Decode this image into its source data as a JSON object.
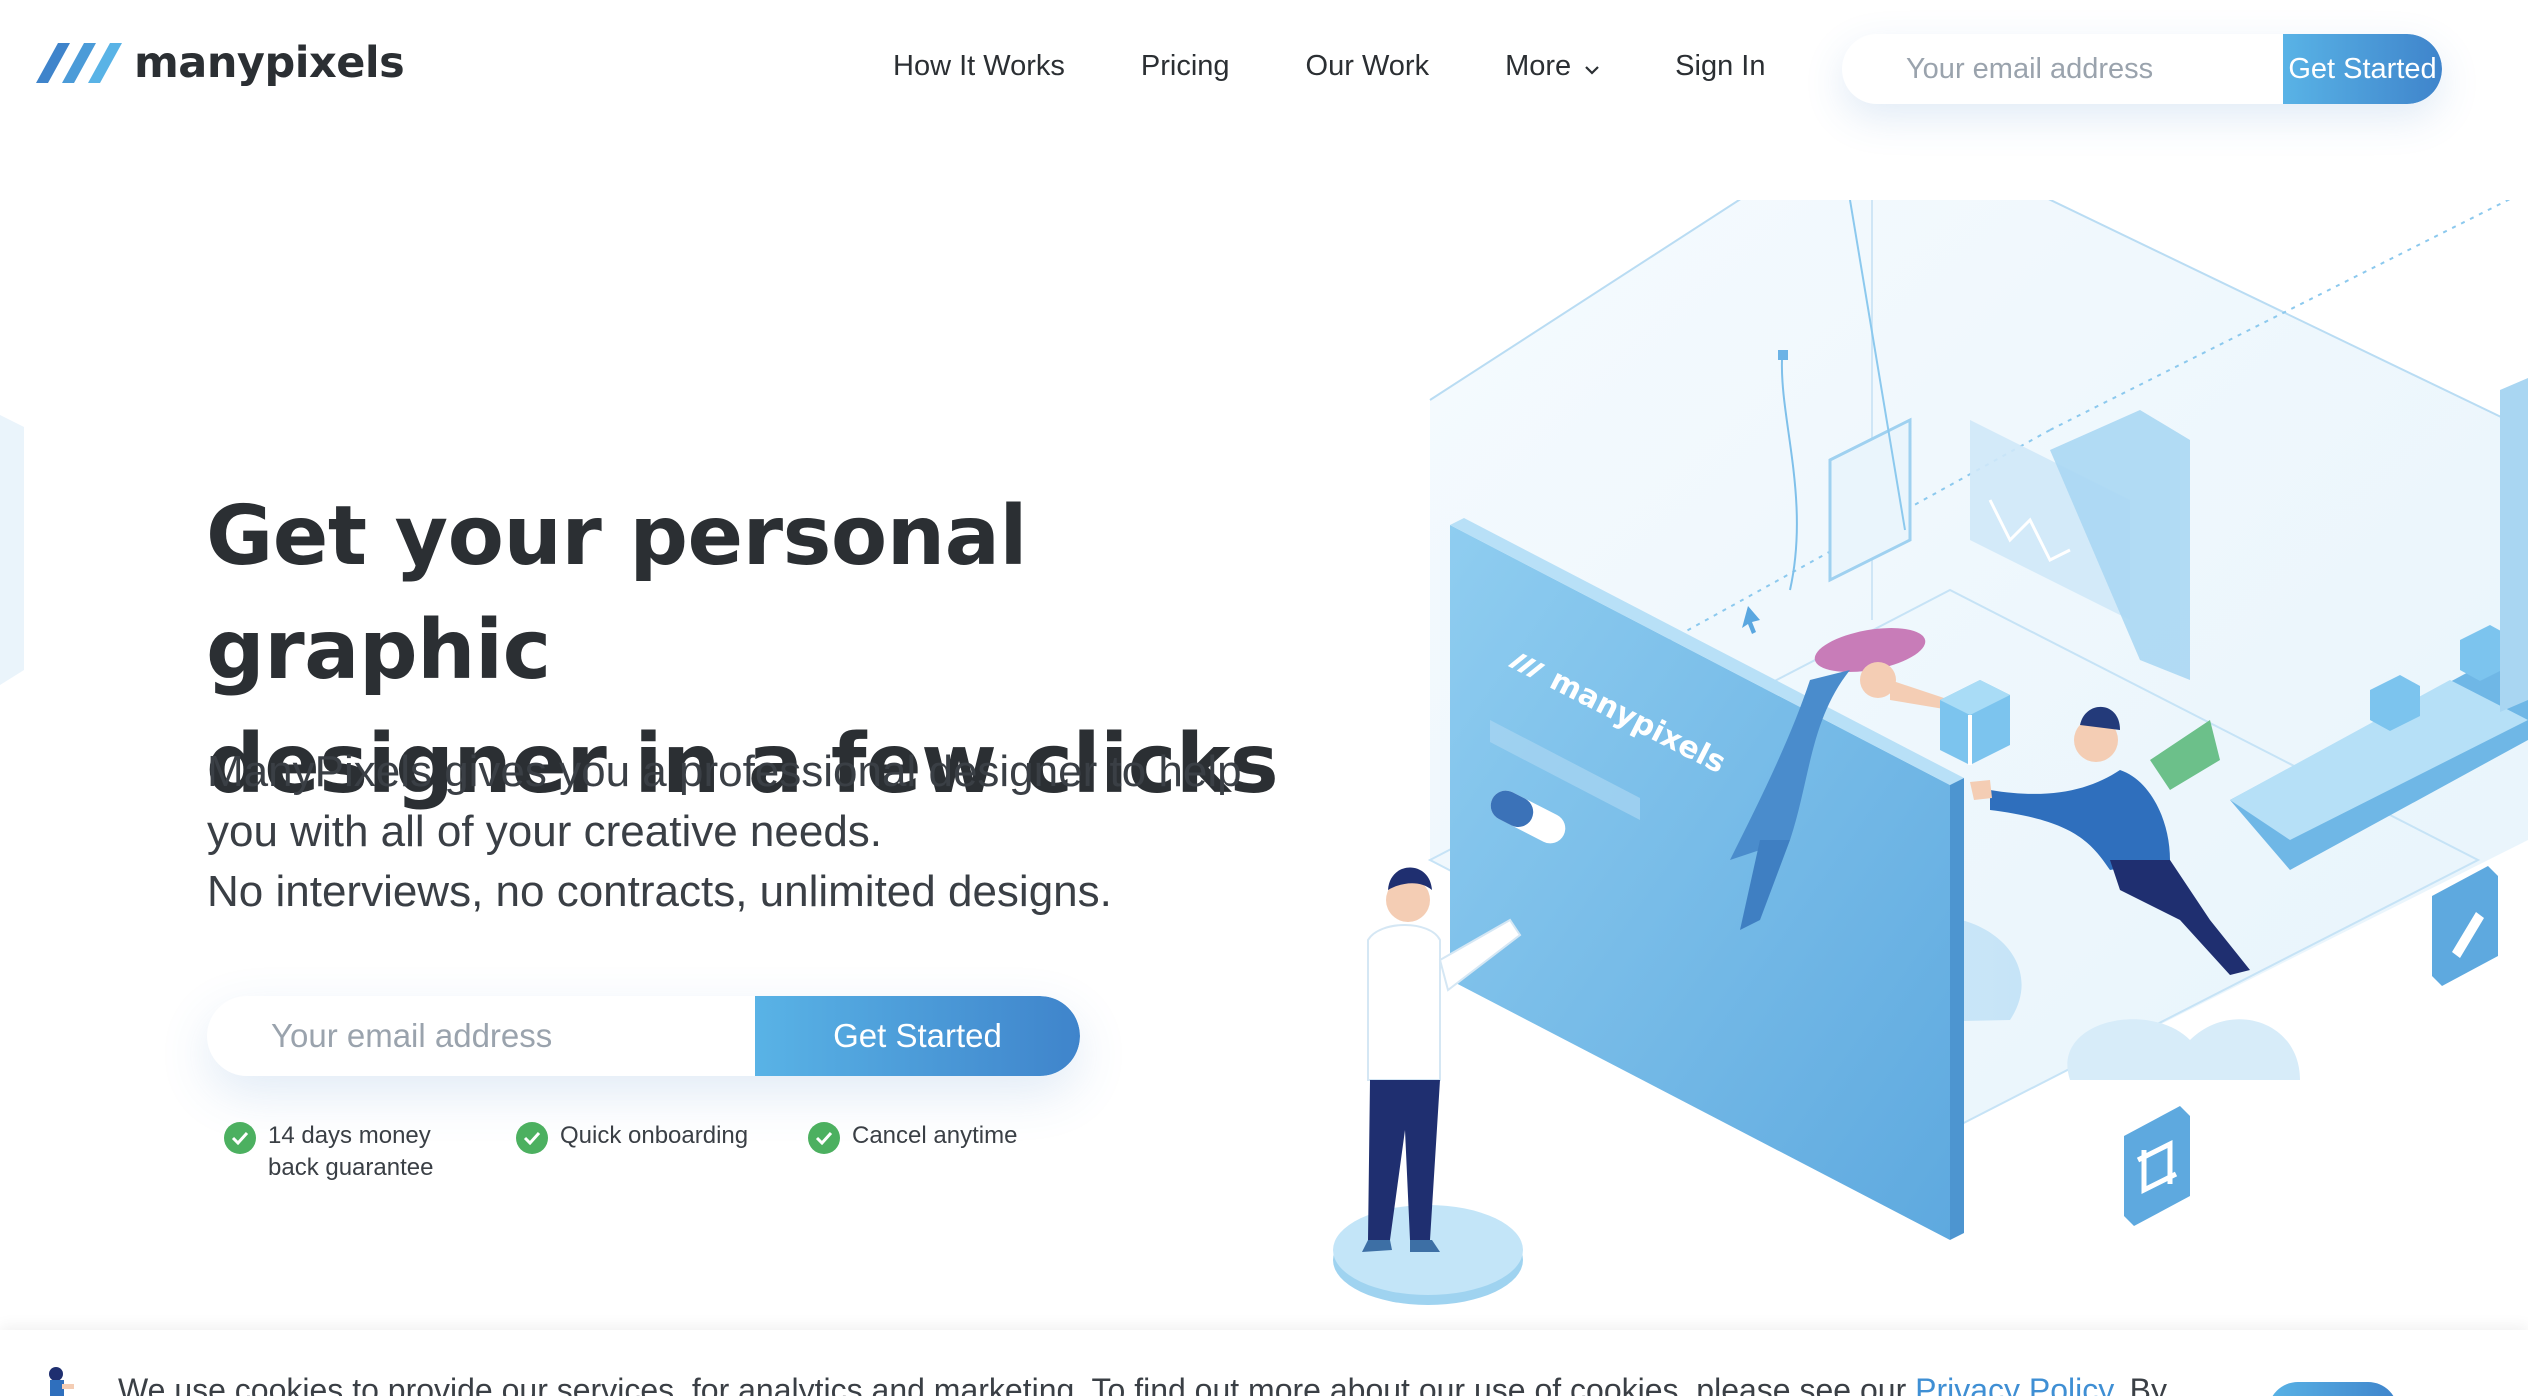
{
  "brand": {
    "name": "manypixels",
    "accent_color": "#4a90d6",
    "button_gradient": [
      "#59b3e6",
      "#3f84cb"
    ],
    "check_color": "#4cb060"
  },
  "nav": {
    "items": [
      {
        "label": "How It Works"
      },
      {
        "label": "Pricing"
      },
      {
        "label": "Our Work"
      },
      {
        "label": "More",
        "icon": "chevron-down-icon"
      },
      {
        "label": "Sign In"
      }
    ]
  },
  "header_form": {
    "placeholder": "Your email address",
    "button_label": "Get Started"
  },
  "hero": {
    "title_line1": "Get your personal graphic",
    "title_line2": "designer in a few clicks",
    "subtitle_line1": "ManyPixels gives you a professional designer to help",
    "subtitle_line2": "you with all of your creative needs.",
    "subtitle_line3": "No interviews, no contracts, unlimited designs.",
    "email_placeholder": "Your email address",
    "button_label": "Get Started",
    "features": [
      {
        "line1": "14 days money",
        "line2": "back guarantee",
        "icon": "check-icon"
      },
      {
        "line1": "Quick onboarding",
        "icon": "check-icon"
      },
      {
        "line1": "Cancel anytime",
        "icon": "check-icon"
      }
    ]
  },
  "illustration": {
    "brand_text": "manypixels"
  },
  "cookie": {
    "text": "We use cookies to provide our services, for analytics and marketing. To find out more about our use of cookies, please see our",
    "link_label": "Privacy Policy",
    "text_after": ". By"
  }
}
